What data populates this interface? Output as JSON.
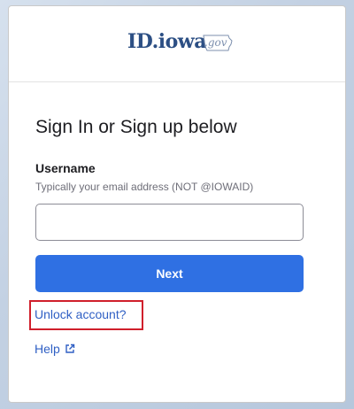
{
  "logo": {
    "main_text": "ID.iowa",
    "gov_text": ".gov",
    "icon": "iowa-state-outline"
  },
  "form": {
    "title": "Sign In or Sign up below",
    "username_label": "Username",
    "username_hint": "Typically your email address (NOT @IOWAID)",
    "username_value": "",
    "username_placeholder": "",
    "next_label": "Next"
  },
  "links": {
    "unlock_label": "Unlock account?",
    "help_label": "Help",
    "help_icon": "external-link-icon"
  },
  "colors": {
    "primary_button": "#2f70e3",
    "link": "#2f5fc4",
    "highlight_border": "#d01f2c",
    "logo_blue": "#2c4f84"
  }
}
